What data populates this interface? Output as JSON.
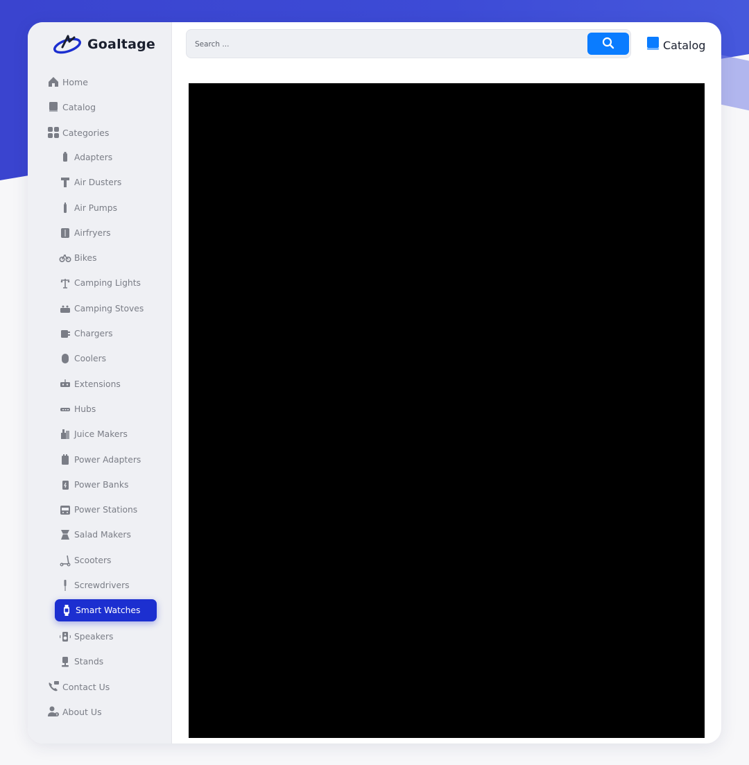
{
  "brand": {
    "name": "Goaltage",
    "accent_color": "#1c2fd0",
    "logo_icon": "swoosh-logo-icon"
  },
  "header": {
    "search": {
      "placeholder": "Search ...",
      "value": "",
      "button_icon": "search-icon"
    },
    "catalog_link": {
      "label": "Catalog",
      "icon": "book-icon"
    }
  },
  "sidebar": {
    "top_items": [
      {
        "label": "Home",
        "icon": "home-icon"
      },
      {
        "label": "Catalog",
        "icon": "book-icon"
      },
      {
        "label": "Categories",
        "icon": "grid-icon"
      }
    ],
    "categories": [
      {
        "label": "Adapters",
        "icon": "adapter-icon"
      },
      {
        "label": "Air Dusters",
        "icon": "air-duster-icon"
      },
      {
        "label": "Air Pumps",
        "icon": "air-pump-icon"
      },
      {
        "label": "Airfryers",
        "icon": "airfryer-icon"
      },
      {
        "label": "Bikes",
        "icon": "bike-icon"
      },
      {
        "label": "Camping Lights",
        "icon": "camping-light-icon"
      },
      {
        "label": "Camping Stoves",
        "icon": "camping-stove-icon"
      },
      {
        "label": "Chargers",
        "icon": "charger-icon"
      },
      {
        "label": "Coolers",
        "icon": "cooler-icon"
      },
      {
        "label": "Extensions",
        "icon": "extension-icon"
      },
      {
        "label": "Hubs",
        "icon": "hub-icon"
      },
      {
        "label": "Juice Makers",
        "icon": "juice-maker-icon"
      },
      {
        "label": "Power Adapters",
        "icon": "power-adapter-icon"
      },
      {
        "label": "Power Banks",
        "icon": "power-bank-icon"
      },
      {
        "label": "Power Stations",
        "icon": "power-station-icon"
      },
      {
        "label": "Salad Makers",
        "icon": "salad-maker-icon"
      },
      {
        "label": "Scooters",
        "icon": "scooter-icon"
      },
      {
        "label": "Screwdrivers",
        "icon": "screwdriver-icon"
      },
      {
        "label": "Smart Watches",
        "icon": "smart-watch-icon",
        "active": true
      },
      {
        "label": "Speakers",
        "icon": "speaker-icon"
      },
      {
        "label": "Stands",
        "icon": "stand-icon"
      }
    ],
    "bottom_items": [
      {
        "label": "Contact Us",
        "icon": "contact-icon"
      },
      {
        "label": "About Us",
        "icon": "about-icon"
      }
    ]
  },
  "main": {
    "viewer_background": "#000000"
  }
}
